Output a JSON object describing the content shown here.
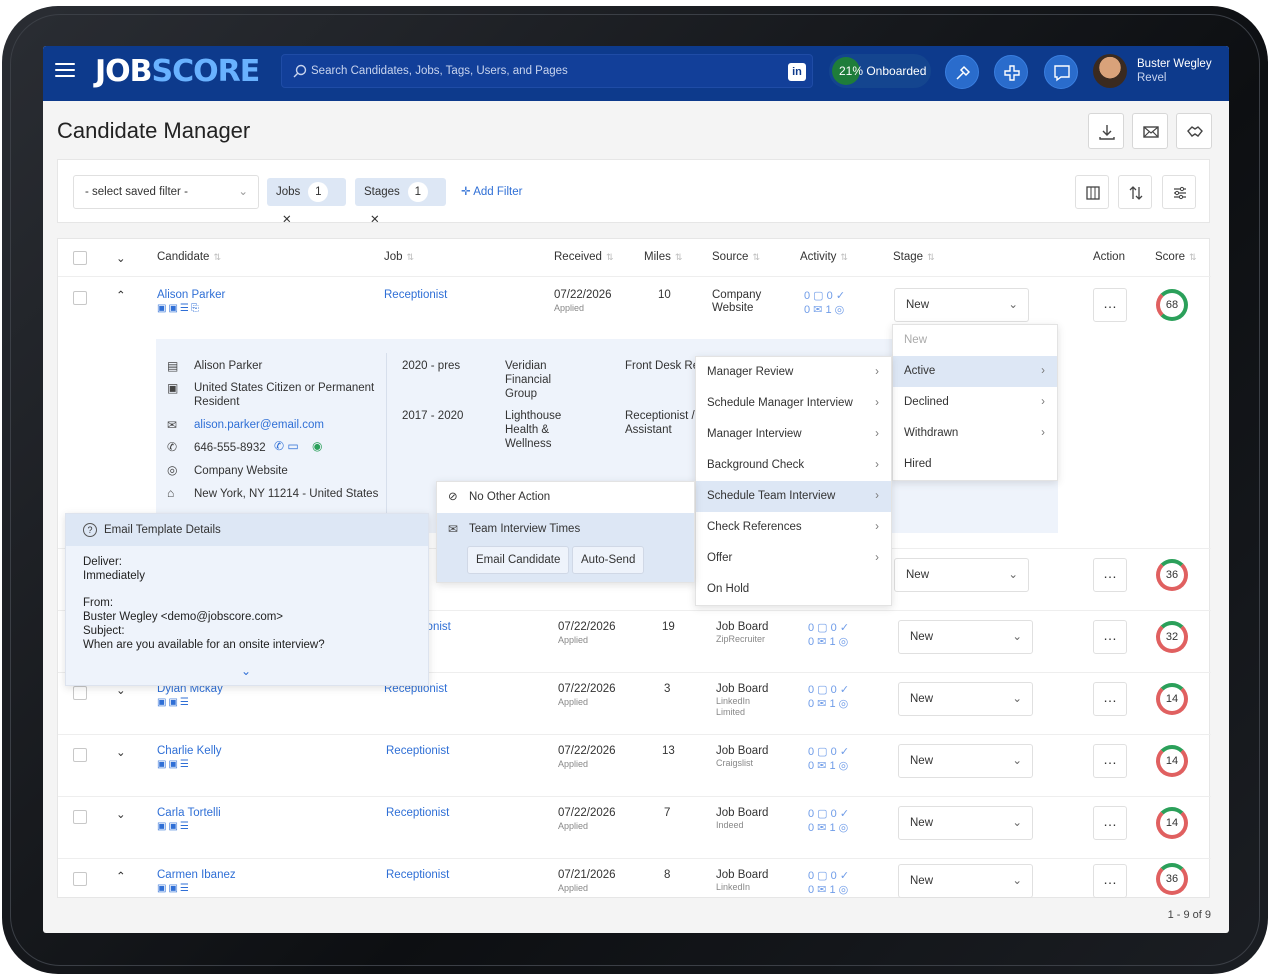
{
  "app": {
    "logo_a": "JOB",
    "logo_b": "SCORE",
    "search_placeholder": "Search Candidates, Jobs, Tags, Users, and Pages",
    "linkedin": "in",
    "onboarded": "21% Onboarded",
    "user_name": "Buster Wegley",
    "user_org": "Revel"
  },
  "page": {
    "title": "Candidate Manager"
  },
  "filters": {
    "saved": "- select saved filter -",
    "chips": [
      {
        "label": "Jobs",
        "count": "1"
      },
      {
        "label": "Stages",
        "count": "1"
      }
    ],
    "add": "Add Filter"
  },
  "columns": {
    "candidate": "Candidate",
    "job": "Job",
    "received": "Received",
    "miles": "Miles",
    "source": "Source",
    "activity": "Activity",
    "stage": "Stage",
    "action": "Action",
    "score": "Score"
  },
  "rows": [
    {
      "name": "Alison Parker",
      "job": "Receptionist",
      "date": "07/22/2026",
      "status": "Applied",
      "miles": "10",
      "source": "Company",
      "source2": "Website",
      "stage": "New",
      "score": "68"
    },
    {
      "name": "",
      "job": "",
      "date": "",
      "status": "",
      "miles": "",
      "source": "",
      "source2": "",
      "stage": "New",
      "score": "36"
    },
    {
      "name": "",
      "job": "ionist",
      "date": "07/22/2026",
      "status": "Applied",
      "miles": "19",
      "source": "Job Board",
      "source2": "ZipRecruiter",
      "stage": "New",
      "score": "32"
    },
    {
      "name": "Dylan Mckay",
      "job": "Receptionist",
      "date": "07/22/2026",
      "status": "Applied",
      "miles": "3",
      "source": "Job Board",
      "source2": "LinkedIn Limited",
      "stage": "New",
      "score": "14"
    },
    {
      "name": "Charlie Kelly",
      "job": "Receptionist",
      "date": "07/22/2026",
      "status": "Applied",
      "miles": "13",
      "source": "Job Board",
      "source2": "Craigslist",
      "stage": "New",
      "score": "14"
    },
    {
      "name": "Carla Tortelli",
      "job": "Receptionist",
      "date": "07/22/2026",
      "status": "Applied",
      "miles": "7",
      "source": "Job Board",
      "source2": "Indeed",
      "stage": "New",
      "score": "14"
    },
    {
      "name": "Carmen Ibanez",
      "job": "Receptionist",
      "date": "07/21/2026",
      "status": "Applied",
      "miles": "8",
      "source": "Job Board",
      "source2": "LinkedIn",
      "stage": "New",
      "score": "36"
    }
  ],
  "activity": {
    "a": "0",
    "b": "0",
    "c": "0",
    "d": "1"
  },
  "detail": {
    "name": "Alison Parker",
    "citizen": "United States Citizen or Permanent Resident",
    "email": "alison.parker@email.com",
    "phone": "646-555-8932",
    "source": "Company Website",
    "location": "New York, NY 11214 - United States",
    "exp": [
      {
        "years": "2020 - pres",
        "company": "Veridian Financial Group",
        "title": "Front Desk Re"
      },
      {
        "years": "2017 - 2020",
        "company": "Lighthouse Health & Wellness",
        "title": "Receptionist / Assistant"
      }
    ]
  },
  "stage_menu": {
    "items": [
      "New",
      "Active",
      "Declined",
      "Withdrawn",
      "Hired"
    ]
  },
  "sub_menu": {
    "items": [
      "Manager Review",
      "Schedule Manager Interview",
      "Manager Interview",
      "Background Check",
      "Schedule Team Interview",
      "Check References",
      "Offer",
      "On Hold"
    ]
  },
  "action_menu": {
    "no_action": "No Other Action",
    "team_times": "Team Interview Times",
    "email_btn": "Email Candidate",
    "auto_btn": "Auto-Send"
  },
  "email_template": {
    "title": "Email Template Details",
    "deliver_label": "Deliver:",
    "deliver": "Immediately",
    "from_label": "From:",
    "from": "Buster Wegley <demo@jobscore.com>",
    "subject_label": "Subject:",
    "subject": "When are you available for an onsite interview?"
  },
  "pagination": "1 - 9 of 9"
}
